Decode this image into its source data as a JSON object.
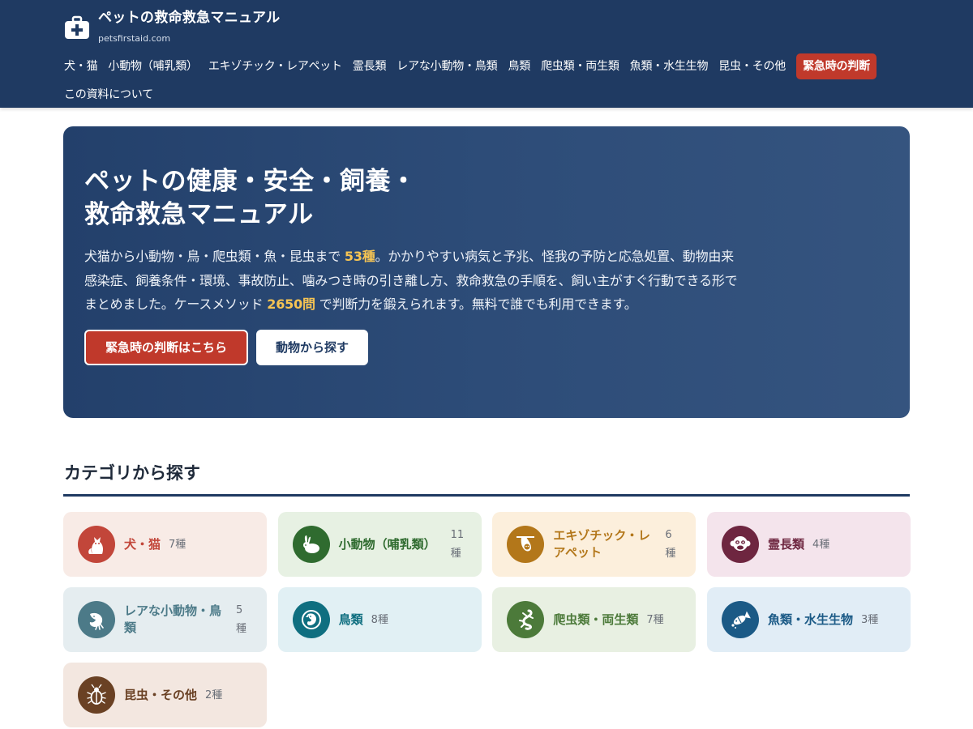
{
  "header": {
    "title": "ペットの救命救急マニュアル",
    "domain": "petsfirstaid.com",
    "nav": [
      {
        "label": "犬・猫"
      },
      {
        "label": "小動物（哺乳類）"
      },
      {
        "label": "エキゾチック・レアペット"
      },
      {
        "label": "霊長類"
      },
      {
        "label": "レアな小動物・鳥類"
      },
      {
        "label": "鳥類"
      },
      {
        "label": "爬虫類・両生類"
      },
      {
        "label": "魚類・水生生物"
      },
      {
        "label": "昆虫・その他"
      },
      {
        "label": "緊急時の判断"
      },
      {
        "label": "この資料について"
      }
    ]
  },
  "hero": {
    "title_line1": "ペットの健康・安全・飼養・",
    "title_line2": "救命救急マニュアル",
    "desc_part1": "犬猫から小動物・鳥・爬虫類・魚・昆虫まで ",
    "desc_hl1": "53種",
    "desc_part2": "。かかりやすい病気と予兆、怪我の予防と応急処置、動物由来感染症、飼養条件・環境、事故防止、噛みつき時の引き離し方、救命救急の手順を、飼い主がすぐ行動できる形でまとめました。ケースメソッド ",
    "desc_hl2": "2650問",
    "desc_part3": " で判断力を鍛えられます。無料で誰でも利用できます。",
    "btn_primary": "緊急時の判断はこちら",
    "btn_secondary": "動物から探す"
  },
  "categories_section": {
    "title": "カテゴリから探す",
    "items": [
      {
        "name": "犬・猫",
        "count": "7種",
        "icon": "dog-cat-icon",
        "bg": "#f8ebe6",
        "accent": "#c2463a"
      },
      {
        "name": "小動物（哺乳類）",
        "count": "11種",
        "icon": "rabbit-icon",
        "bg": "#e7f1e3",
        "accent": "#2f6b2f"
      },
      {
        "name": "エキゾチック・レアペット",
        "count": "6種",
        "icon": "sloth-icon",
        "bg": "#fcefdc",
        "accent": "#b3771a"
      },
      {
        "name": "霊長類",
        "count": "4種",
        "icon": "monkey-icon",
        "bg": "#f4e4ec",
        "accent": "#6e2640"
      },
      {
        "name": "レアな小動物・鳥類",
        "count": "5種",
        "icon": "bird-claw-icon",
        "bg": "#e5edf0",
        "accent": "#4c7a88"
      },
      {
        "name": "鳥類",
        "count": "8種",
        "icon": "parrot-icon",
        "bg": "#e1f0f4",
        "accent": "#0f6f80"
      },
      {
        "name": "爬虫類・両生類",
        "count": "7種",
        "icon": "lizard-icon",
        "bg": "#e8f0e2",
        "accent": "#4c7a3a"
      },
      {
        "name": "魚類・水生生物",
        "count": "3種",
        "icon": "fish-icon",
        "bg": "#e1edf6",
        "accent": "#1b5a86"
      },
      {
        "name": "昆虫・その他",
        "count": "2種",
        "icon": "beetle-icon",
        "bg": "#f3e7e0",
        "accent": "#6a4124"
      }
    ]
  },
  "colors": {
    "header_bg": "#1f3a62",
    "emergency": "#c0392b",
    "highlight": "#f6c453"
  }
}
